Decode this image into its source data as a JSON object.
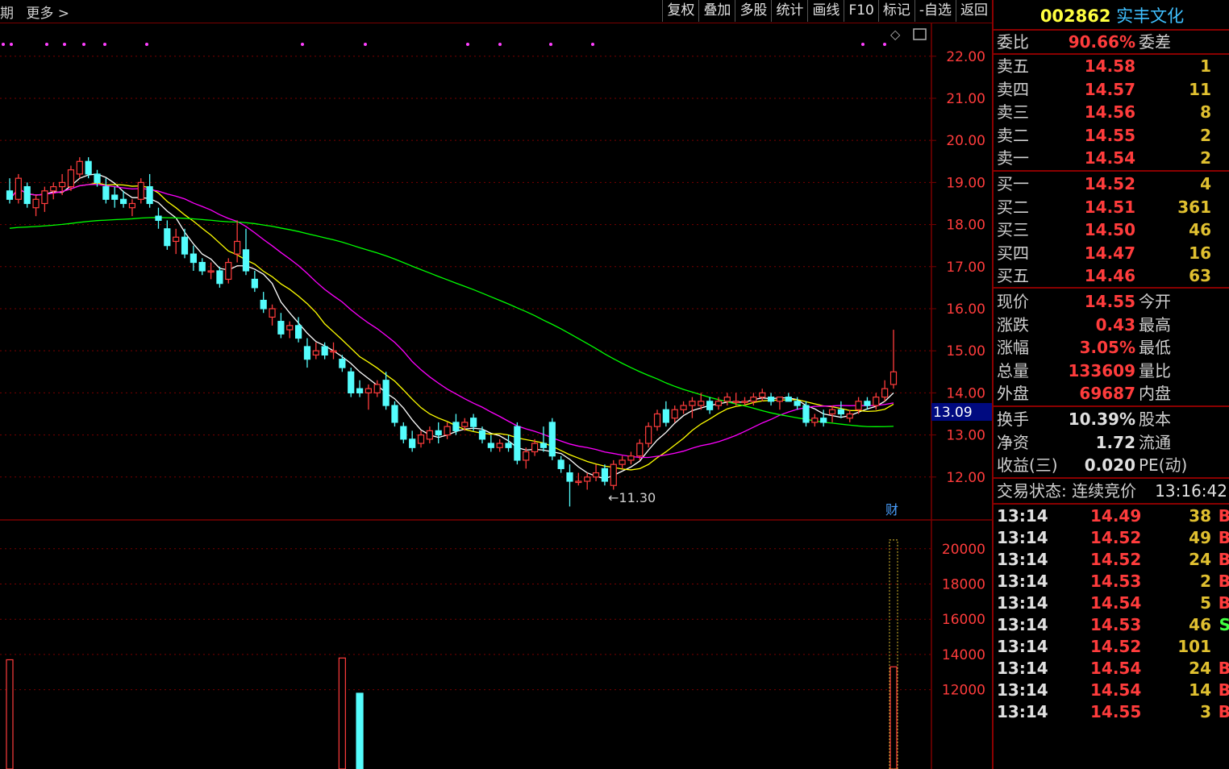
{
  "topbar": {
    "left_items": [
      "期",
      "更多 >"
    ]
  },
  "toolbar": {
    "items": [
      "复权",
      "叠加",
      "多股",
      "统计",
      "画线",
      "F10",
      "标记",
      "-自选",
      "返回"
    ]
  },
  "stock": {
    "code": "002862",
    "name": "实丰文化"
  },
  "order_book": {
    "weibi_label": "委比",
    "weibi_value": "90.66%",
    "weicha_label": "委差",
    "sell": [
      {
        "label": "卖五",
        "price": "14.58",
        "vol": "1"
      },
      {
        "label": "卖四",
        "price": "14.57",
        "vol": "11"
      },
      {
        "label": "卖三",
        "price": "14.56",
        "vol": "8"
      },
      {
        "label": "卖二",
        "price": "14.55",
        "vol": "2"
      },
      {
        "label": "卖一",
        "price": "14.54",
        "vol": "2"
      }
    ],
    "buy": [
      {
        "label": "买一",
        "price": "14.52",
        "vol": "4"
      },
      {
        "label": "买二",
        "price": "14.51",
        "vol": "361"
      },
      {
        "label": "买三",
        "price": "14.50",
        "vol": "46"
      },
      {
        "label": "买四",
        "price": "14.47",
        "vol": "16"
      },
      {
        "label": "买五",
        "price": "14.46",
        "vol": "63"
      }
    ]
  },
  "quote": [
    {
      "l1": "现价",
      "v1": "14.55",
      "l2": "今开"
    },
    {
      "l1": "涨跌",
      "v1": "0.43",
      "l2": "最高"
    },
    {
      "l1": "涨幅",
      "v1": "3.05%",
      "l2": "最低"
    },
    {
      "l1": "总量",
      "v1": "133609",
      "l2": "量比"
    },
    {
      "l1": "外盘",
      "v1": "69687",
      "l2": "内盘"
    }
  ],
  "quote2": [
    {
      "l1": "换手",
      "v1": "10.39%",
      "l2": "股本"
    },
    {
      "l1": "净资",
      "v1": "1.72",
      "l2": "流通"
    },
    {
      "l1": "收益(三)",
      "v1": "0.020",
      "l2": "PE(动)"
    }
  ],
  "trade_status": {
    "label": "交易状态: 连续竞价",
    "time": "13:16:42"
  },
  "ticks": [
    {
      "time": "13:14",
      "price": "14.49",
      "vol": "38",
      "side": "B"
    },
    {
      "time": "13:14",
      "price": "14.52",
      "vol": "49",
      "side": "B"
    },
    {
      "time": "13:14",
      "price": "14.52",
      "vol": "24",
      "side": "B"
    },
    {
      "time": "13:14",
      "price": "14.53",
      "vol": "2",
      "side": "B"
    },
    {
      "time": "13:14",
      "price": "14.54",
      "vol": "5",
      "side": "B"
    },
    {
      "time": "13:14",
      "price": "14.53",
      "vol": "46",
      "side": "S"
    },
    {
      "time": "13:14",
      "price": "14.52",
      "vol": "101",
      "side": ""
    },
    {
      "time": "13:14",
      "price": "14.54",
      "vol": "24",
      "side": "B"
    },
    {
      "time": "13:14",
      "price": "14.54",
      "vol": "14",
      "side": "B"
    },
    {
      "time": "13:14",
      "price": "14.55",
      "vol": "3",
      "side": "B"
    }
  ],
  "colors": {
    "up": "#ff3c3c",
    "down": "#54fcfc",
    "ma5": "#ffffff",
    "ma10": "#ffff00",
    "ma20": "#ff00ff",
    "ma60": "#00ff00",
    "grid": "#7a0000"
  },
  "chart_data": {
    "type": "candlestick",
    "price_axis": {
      "ticks": [
        "22.00",
        "21.00",
        "20.00",
        "19.00",
        "18.00",
        "17.00",
        "16.00",
        "15.00",
        "14.00",
        "13.00",
        "12.00"
      ],
      "ylim": [
        11.0,
        22.8
      ]
    },
    "volume_axis": {
      "ticks": [
        "20000",
        "18000",
        "16000",
        "14000",
        "12000"
      ],
      "ylim": [
        7500,
        21500
      ]
    },
    "current_price_marker": "13.09",
    "low_annotation": "11.30",
    "fin_badge": "财",
    "candles": [
      [
        18.8,
        19.1,
        18.5,
        18.6
      ],
      [
        18.6,
        19.2,
        18.5,
        19.1
      ],
      [
        18.9,
        19.0,
        18.4,
        18.5
      ],
      [
        18.4,
        18.7,
        18.2,
        18.6
      ],
      [
        18.5,
        18.9,
        18.3,
        18.8
      ],
      [
        18.8,
        19.0,
        18.6,
        18.9
      ],
      [
        18.9,
        19.2,
        18.7,
        19.0
      ],
      [
        18.9,
        19.4,
        18.8,
        19.3
      ],
      [
        19.2,
        19.6,
        19.1,
        19.5
      ],
      [
        19.5,
        19.6,
        19.1,
        19.2
      ],
      [
        19.2,
        19.3,
        18.9,
        19.0
      ],
      [
        18.9,
        19.1,
        18.5,
        18.6
      ],
      [
        18.7,
        18.9,
        18.4,
        18.6
      ],
      [
        18.6,
        18.8,
        18.4,
        18.5
      ],
      [
        18.4,
        18.6,
        18.2,
        18.5
      ],
      [
        18.6,
        19.1,
        18.5,
        19.0
      ],
      [
        18.9,
        19.2,
        18.4,
        18.5
      ],
      [
        18.2,
        18.4,
        17.9,
        18.1
      ],
      [
        17.9,
        18.1,
        17.4,
        17.5
      ],
      [
        17.6,
        17.9,
        17.3,
        17.7
      ],
      [
        17.7,
        17.9,
        17.2,
        17.3
      ],
      [
        17.3,
        17.5,
        16.9,
        17.1
      ],
      [
        17.1,
        17.2,
        16.8,
        16.9
      ],
      [
        16.9,
        17.1,
        16.7,
        16.9
      ],
      [
        16.9,
        17.0,
        16.5,
        16.6
      ],
      [
        16.7,
        17.2,
        16.6,
        17.1
      ],
      [
        17.3,
        18.1,
        17.1,
        17.6
      ],
      [
        17.4,
        17.9,
        16.8,
        16.9
      ],
      [
        16.7,
        16.9,
        16.4,
        16.5
      ],
      [
        16.2,
        16.4,
        15.9,
        16.0
      ],
      [
        15.8,
        16.1,
        15.6,
        16.0
      ],
      [
        15.7,
        15.9,
        15.3,
        15.4
      ],
      [
        15.5,
        15.7,
        15.3,
        15.6
      ],
      [
        15.6,
        15.8,
        15.2,
        15.3
      ],
      [
        15.1,
        15.3,
        14.6,
        14.8
      ],
      [
        14.9,
        15.2,
        14.8,
        15.0
      ],
      [
        15.1,
        15.2,
        14.8,
        14.9
      ],
      [
        15.0,
        15.2,
        14.8,
        15.0
      ],
      [
        14.8,
        14.9,
        14.5,
        14.6
      ],
      [
        14.5,
        14.6,
        13.9,
        14.0
      ],
      [
        14.1,
        14.3,
        13.9,
        14.0
      ],
      [
        14.0,
        14.2,
        13.6,
        14.1
      ],
      [
        14.0,
        14.3,
        13.9,
        14.2
      ],
      [
        14.3,
        14.5,
        13.6,
        13.7
      ],
      [
        13.7,
        13.8,
        13.2,
        13.3
      ],
      [
        13.2,
        13.3,
        12.8,
        12.9
      ],
      [
        12.9,
        13.1,
        12.6,
        12.7
      ],
      [
        12.8,
        13.1,
        12.7,
        13.0
      ],
      [
        12.9,
        13.2,
        12.8,
        13.1
      ],
      [
        13.1,
        13.3,
        12.8,
        13.0
      ],
      [
        13.0,
        13.3,
        12.9,
        13.2
      ],
      [
        13.3,
        13.5,
        13.0,
        13.1
      ],
      [
        13.2,
        13.4,
        13.1,
        13.3
      ],
      [
        13.4,
        13.5,
        13.1,
        13.2
      ],
      [
        13.1,
        13.2,
        12.8,
        12.9
      ],
      [
        12.8,
        13.0,
        12.6,
        12.7
      ],
      [
        12.7,
        12.9,
        12.6,
        12.8
      ],
      [
        12.8,
        13.0,
        12.6,
        12.7
      ],
      [
        13.2,
        13.3,
        12.3,
        12.4
      ],
      [
        12.4,
        12.7,
        12.2,
        12.6
      ],
      [
        12.6,
        12.9,
        12.5,
        12.8
      ],
      [
        12.8,
        13.2,
        12.6,
        12.7
      ],
      [
        13.3,
        13.4,
        12.4,
        12.5
      ],
      [
        12.4,
        12.5,
        12.1,
        12.2
      ],
      [
        12.1,
        12.3,
        11.3,
        11.9
      ],
      [
        11.9,
        12.1,
        11.8,
        11.9
      ],
      [
        11.9,
        12.1,
        11.7,
        12.0
      ],
      [
        12.0,
        12.3,
        11.9,
        12.1
      ],
      [
        12.2,
        12.3,
        11.8,
        11.9
      ],
      [
        11.8,
        12.4,
        11.7,
        12.3
      ],
      [
        12.3,
        12.5,
        12.2,
        12.4
      ],
      [
        12.4,
        12.6,
        12.3,
        12.5
      ],
      [
        12.5,
        12.9,
        12.4,
        12.8
      ],
      [
        12.8,
        13.3,
        12.7,
        13.2
      ],
      [
        13.2,
        13.6,
        13.1,
        13.5
      ],
      [
        13.6,
        13.8,
        13.2,
        13.3
      ],
      [
        13.4,
        13.7,
        13.3,
        13.6
      ],
      [
        13.6,
        13.8,
        13.5,
        13.7
      ],
      [
        13.7,
        13.9,
        13.4,
        13.8
      ],
      [
        13.7,
        14.0,
        13.6,
        13.8
      ],
      [
        13.8,
        13.9,
        13.5,
        13.6
      ],
      [
        13.7,
        13.9,
        13.6,
        13.8
      ],
      [
        13.8,
        14.0,
        13.7,
        13.9
      ],
      [
        13.8,
        14.0,
        13.7,
        13.8
      ],
      [
        13.8,
        13.9,
        13.7,
        13.8
      ],
      [
        13.8,
        14.0,
        13.7,
        13.9
      ],
      [
        13.9,
        14.1,
        13.8,
        14.0
      ],
      [
        13.9,
        14.0,
        13.7,
        13.8
      ],
      [
        13.8,
        13.9,
        13.6,
        13.9
      ],
      [
        13.9,
        14.0,
        13.8,
        13.8
      ],
      [
        13.8,
        13.9,
        13.6,
        13.7
      ],
      [
        13.7,
        13.8,
        13.2,
        13.3
      ],
      [
        13.3,
        13.5,
        13.2,
        13.4
      ],
      [
        13.4,
        13.6,
        13.2,
        13.3
      ],
      [
        13.5,
        13.7,
        13.3,
        13.6
      ],
      [
        13.6,
        13.8,
        13.4,
        13.5
      ],
      [
        13.4,
        13.6,
        13.3,
        13.5
      ],
      [
        13.6,
        13.9,
        13.5,
        13.8
      ],
      [
        13.8,
        13.9,
        13.6,
        13.7
      ],
      [
        13.7,
        14.0,
        13.6,
        13.9
      ],
      [
        13.9,
        14.3,
        13.8,
        14.1
      ],
      [
        14.2,
        15.5,
        14.1,
        14.5
      ]
    ],
    "volume_bars": [
      {
        "index": 0,
        "value": 13700,
        "up": true
      },
      {
        "index": 38,
        "value": 13800,
        "up": true
      },
      {
        "index": 40,
        "value": 11800,
        "up": false
      },
      {
        "index": 101,
        "value": 13300,
        "up": true
      }
    ]
  }
}
